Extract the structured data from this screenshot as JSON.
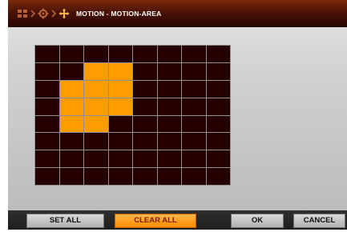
{
  "header": {
    "title": "MOTION - MOTION-AREA",
    "breadcrumb_icons": [
      "grid-icon",
      "gear-icon",
      "motion-icon"
    ],
    "accent_color": "#ff9c00"
  },
  "motion_grid": {
    "rows": 8,
    "cols": 8,
    "active_color": "#ff9c00",
    "inactive_color": "#240000",
    "selected": [
      [
        0,
        0,
        0,
        0,
        0,
        0,
        0,
        0
      ],
      [
        0,
        0,
        1,
        1,
        0,
        0,
        0,
        0
      ],
      [
        0,
        1,
        1,
        1,
        0,
        0,
        0,
        0
      ],
      [
        0,
        1,
        1,
        1,
        0,
        0,
        0,
        0
      ],
      [
        0,
        1,
        1,
        0,
        0,
        0,
        0,
        0
      ],
      [
        0,
        0,
        0,
        0,
        0,
        0,
        0,
        0
      ],
      [
        0,
        0,
        0,
        0,
        0,
        0,
        0,
        0
      ],
      [
        0,
        0,
        0,
        0,
        0,
        0,
        0,
        0
      ]
    ]
  },
  "buttons": {
    "set_all": "SET ALL",
    "clear_all": "CLEAR ALL",
    "ok": "OK",
    "cancel": "CANCEL"
  }
}
